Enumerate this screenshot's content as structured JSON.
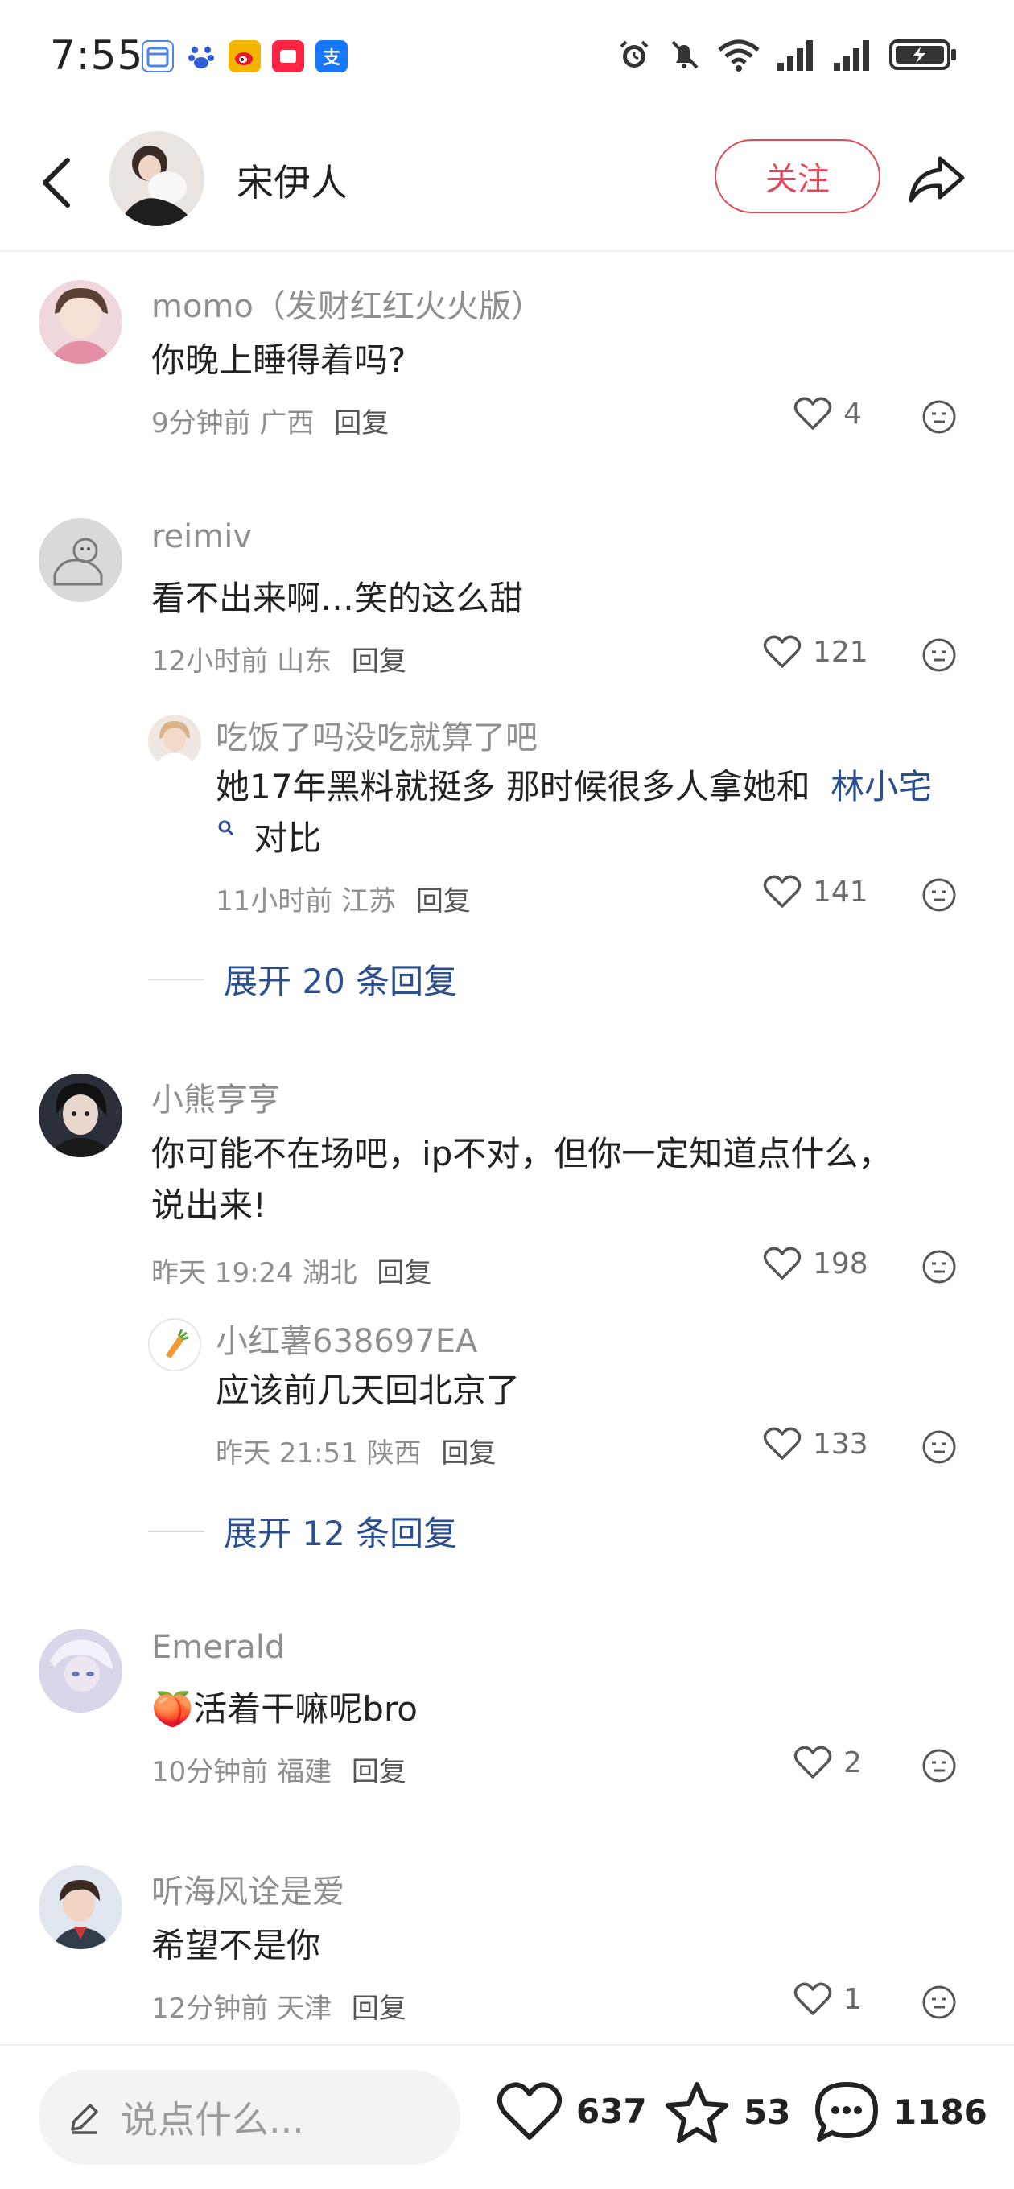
{
  "status_bar": {
    "time": "7:55",
    "app_icons": [
      "calendar-icon",
      "baidu-icon",
      "weibo-icon",
      "red-app-icon",
      "alipay-icon"
    ],
    "right_icons": [
      "alarm-icon",
      "mute-icon",
      "wifi-icon",
      "signal-1-icon",
      "signal-2-icon",
      "battery-charging-icon"
    ]
  },
  "header": {
    "back_icon": "back-chevron-icon",
    "name": "宋伊人",
    "follow_label": "关注",
    "share_icon": "share-icon"
  },
  "comments": [
    {
      "user": "momo（发财红红火火版）",
      "text": "你晚上睡得着吗?",
      "time": "9分钟前",
      "location": "广西",
      "reply_label": "回复",
      "likes": "4",
      "replies": []
    },
    {
      "user": "reimiv",
      "text": "看不出来啊…笑的这么甜",
      "time": "12小时前",
      "location": "山东",
      "reply_label": "回复",
      "likes": "121",
      "replies": [
        {
          "user": "吃饭了吗没吃就算了吧",
          "text_before": "她17年黑料就挺多 那时候很多人拿她和",
          "link_text": "林小宅",
          "text_after": "对比",
          "time": "11小时前",
          "location": "江苏",
          "reply_label": "回复",
          "likes": "141"
        }
      ],
      "expand_label": "展开 20 条回复"
    },
    {
      "user": "小熊亨亨",
      "text_line1": "你可能不在场吧，ip不对，但你一定知道点什么，",
      "text_line2": "说出来!",
      "time": "昨天 19:24",
      "location": "湖北",
      "reply_label": "回复",
      "likes": "198",
      "replies": [
        {
          "user": "小红薯638697EA",
          "text": "应该前几天回北京了",
          "time": "昨天 21:51",
          "location": "陕西",
          "reply_label": "回复",
          "likes": "133"
        }
      ],
      "expand_label": "展开 12 条回复"
    },
    {
      "user": "Emerald",
      "emoji": "🍑",
      "text": "活着干嘛呢bro",
      "time": "10分钟前",
      "location": "福建",
      "reply_label": "回复",
      "likes": "2"
    },
    {
      "user": "听海风诠是爱",
      "text": "希望不是你",
      "time": "12分钟前",
      "location": "天津",
      "reply_label": "回复",
      "likes": "1"
    }
  ],
  "bottom_bar": {
    "input_placeholder": "说点什么...",
    "likes": "637",
    "favorites": "53",
    "comments": "1186"
  },
  "colors": {
    "accent_red": "#e04a5c",
    "link_blue": "#2b4e8e",
    "meta_gray": "#8f8f8f"
  }
}
